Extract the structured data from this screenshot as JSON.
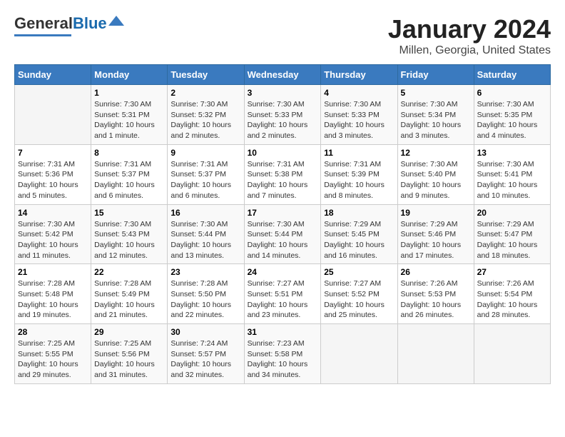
{
  "header": {
    "logo_general": "General",
    "logo_blue": "Blue",
    "title": "January 2024",
    "location": "Millen, Georgia, United States"
  },
  "days_of_week": [
    "Sunday",
    "Monday",
    "Tuesday",
    "Wednesday",
    "Thursday",
    "Friday",
    "Saturday"
  ],
  "weeks": [
    [
      {
        "num": "",
        "info": ""
      },
      {
        "num": "1",
        "info": "Sunrise: 7:30 AM\nSunset: 5:31 PM\nDaylight: 10 hours\nand 1 minute."
      },
      {
        "num": "2",
        "info": "Sunrise: 7:30 AM\nSunset: 5:32 PM\nDaylight: 10 hours\nand 2 minutes."
      },
      {
        "num": "3",
        "info": "Sunrise: 7:30 AM\nSunset: 5:33 PM\nDaylight: 10 hours\nand 2 minutes."
      },
      {
        "num": "4",
        "info": "Sunrise: 7:30 AM\nSunset: 5:33 PM\nDaylight: 10 hours\nand 3 minutes."
      },
      {
        "num": "5",
        "info": "Sunrise: 7:30 AM\nSunset: 5:34 PM\nDaylight: 10 hours\nand 3 minutes."
      },
      {
        "num": "6",
        "info": "Sunrise: 7:30 AM\nSunset: 5:35 PM\nDaylight: 10 hours\nand 4 minutes."
      }
    ],
    [
      {
        "num": "7",
        "info": "Sunrise: 7:31 AM\nSunset: 5:36 PM\nDaylight: 10 hours\nand 5 minutes."
      },
      {
        "num": "8",
        "info": "Sunrise: 7:31 AM\nSunset: 5:37 PM\nDaylight: 10 hours\nand 6 minutes."
      },
      {
        "num": "9",
        "info": "Sunrise: 7:31 AM\nSunset: 5:37 PM\nDaylight: 10 hours\nand 6 minutes."
      },
      {
        "num": "10",
        "info": "Sunrise: 7:31 AM\nSunset: 5:38 PM\nDaylight: 10 hours\nand 7 minutes."
      },
      {
        "num": "11",
        "info": "Sunrise: 7:31 AM\nSunset: 5:39 PM\nDaylight: 10 hours\nand 8 minutes."
      },
      {
        "num": "12",
        "info": "Sunrise: 7:30 AM\nSunset: 5:40 PM\nDaylight: 10 hours\nand 9 minutes."
      },
      {
        "num": "13",
        "info": "Sunrise: 7:30 AM\nSunset: 5:41 PM\nDaylight: 10 hours\nand 10 minutes."
      }
    ],
    [
      {
        "num": "14",
        "info": "Sunrise: 7:30 AM\nSunset: 5:42 PM\nDaylight: 10 hours\nand 11 minutes."
      },
      {
        "num": "15",
        "info": "Sunrise: 7:30 AM\nSunset: 5:43 PM\nDaylight: 10 hours\nand 12 minutes."
      },
      {
        "num": "16",
        "info": "Sunrise: 7:30 AM\nSunset: 5:44 PM\nDaylight: 10 hours\nand 13 minutes."
      },
      {
        "num": "17",
        "info": "Sunrise: 7:30 AM\nSunset: 5:44 PM\nDaylight: 10 hours\nand 14 minutes."
      },
      {
        "num": "18",
        "info": "Sunrise: 7:29 AM\nSunset: 5:45 PM\nDaylight: 10 hours\nand 16 minutes."
      },
      {
        "num": "19",
        "info": "Sunrise: 7:29 AM\nSunset: 5:46 PM\nDaylight: 10 hours\nand 17 minutes."
      },
      {
        "num": "20",
        "info": "Sunrise: 7:29 AM\nSunset: 5:47 PM\nDaylight: 10 hours\nand 18 minutes."
      }
    ],
    [
      {
        "num": "21",
        "info": "Sunrise: 7:28 AM\nSunset: 5:48 PM\nDaylight: 10 hours\nand 19 minutes."
      },
      {
        "num": "22",
        "info": "Sunrise: 7:28 AM\nSunset: 5:49 PM\nDaylight: 10 hours\nand 21 minutes."
      },
      {
        "num": "23",
        "info": "Sunrise: 7:28 AM\nSunset: 5:50 PM\nDaylight: 10 hours\nand 22 minutes."
      },
      {
        "num": "24",
        "info": "Sunrise: 7:27 AM\nSunset: 5:51 PM\nDaylight: 10 hours\nand 23 minutes."
      },
      {
        "num": "25",
        "info": "Sunrise: 7:27 AM\nSunset: 5:52 PM\nDaylight: 10 hours\nand 25 minutes."
      },
      {
        "num": "26",
        "info": "Sunrise: 7:26 AM\nSunset: 5:53 PM\nDaylight: 10 hours\nand 26 minutes."
      },
      {
        "num": "27",
        "info": "Sunrise: 7:26 AM\nSunset: 5:54 PM\nDaylight: 10 hours\nand 28 minutes."
      }
    ],
    [
      {
        "num": "28",
        "info": "Sunrise: 7:25 AM\nSunset: 5:55 PM\nDaylight: 10 hours\nand 29 minutes."
      },
      {
        "num": "29",
        "info": "Sunrise: 7:25 AM\nSunset: 5:56 PM\nDaylight: 10 hours\nand 31 minutes."
      },
      {
        "num": "30",
        "info": "Sunrise: 7:24 AM\nSunset: 5:57 PM\nDaylight: 10 hours\nand 32 minutes."
      },
      {
        "num": "31",
        "info": "Sunrise: 7:23 AM\nSunset: 5:58 PM\nDaylight: 10 hours\nand 34 minutes."
      },
      {
        "num": "",
        "info": ""
      },
      {
        "num": "",
        "info": ""
      },
      {
        "num": "",
        "info": ""
      }
    ]
  ]
}
